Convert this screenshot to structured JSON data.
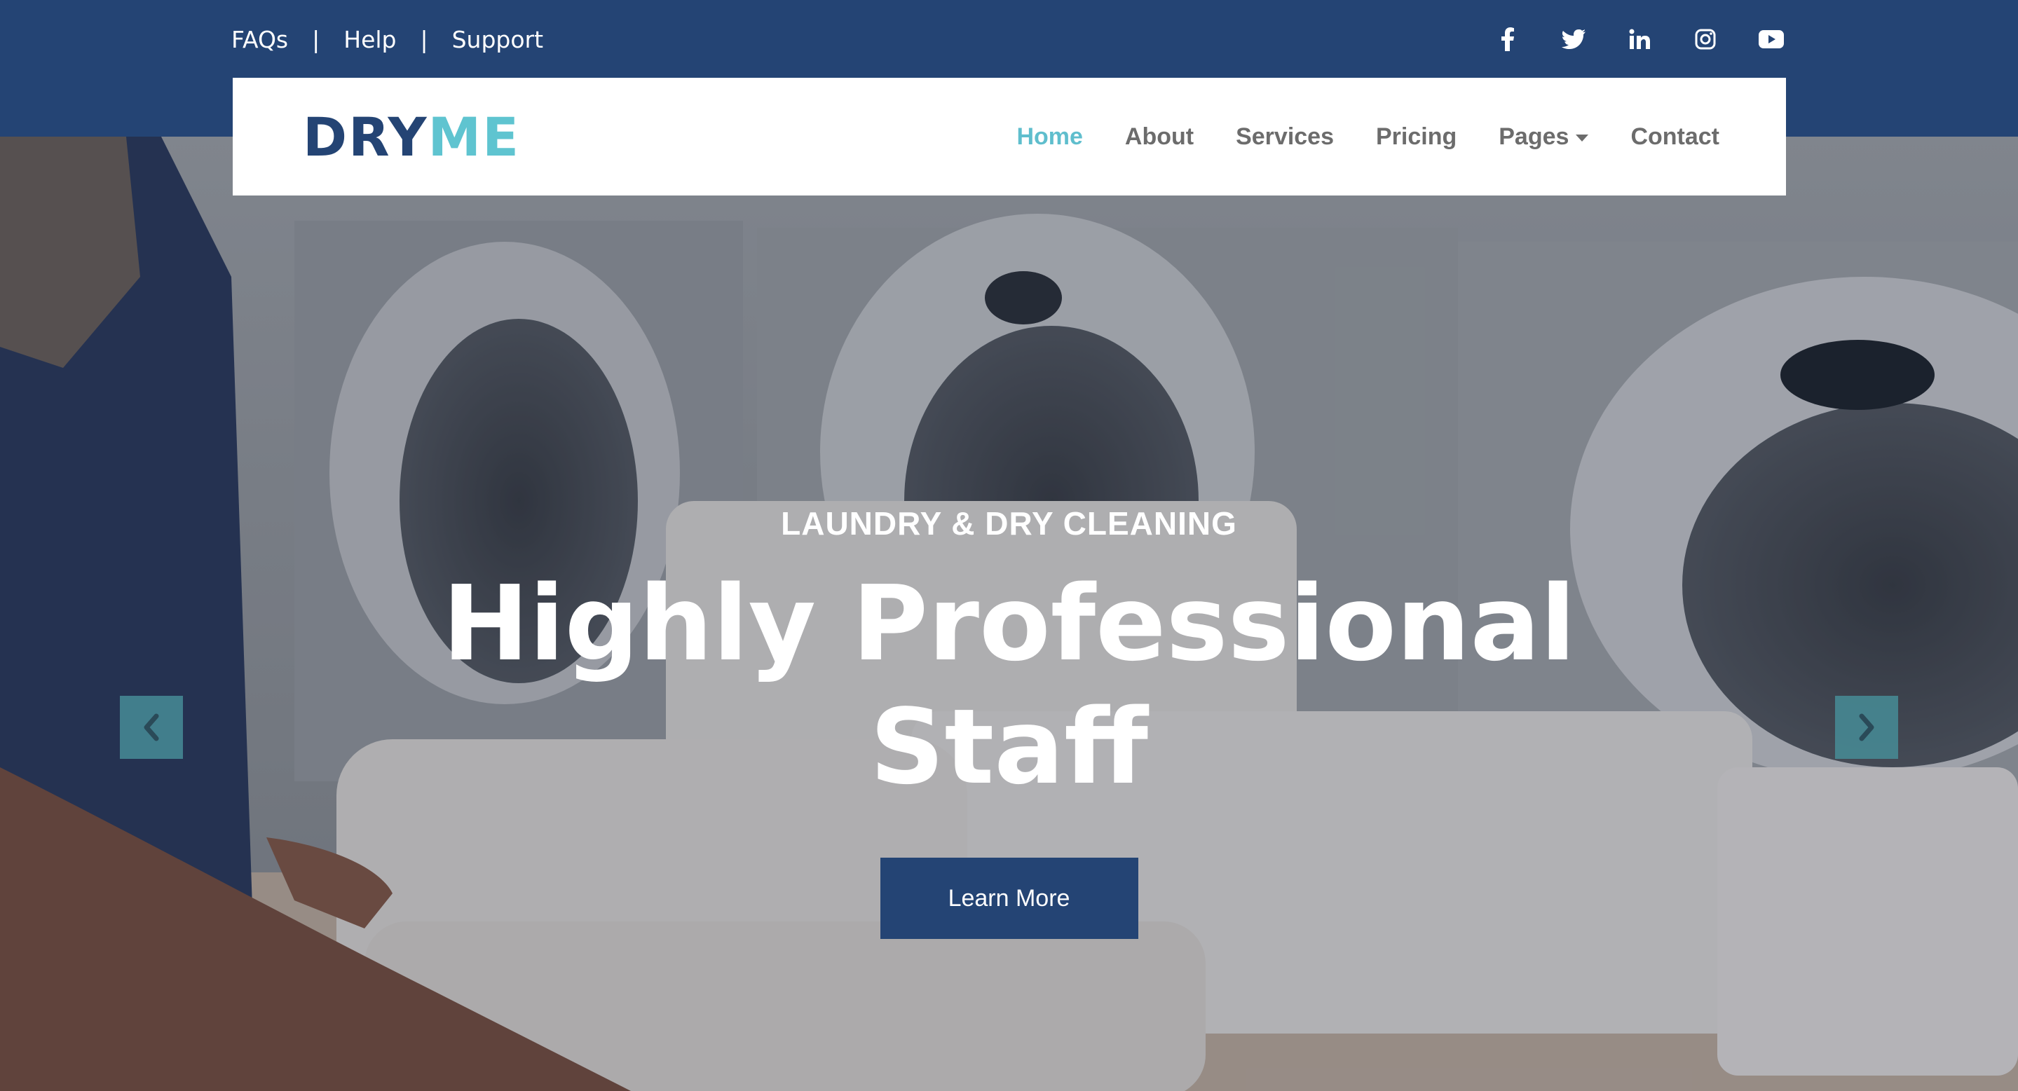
{
  "topbar": {
    "links": [
      "FAQs",
      "Help",
      "Support"
    ],
    "separator": "|",
    "social": [
      "facebook-icon",
      "twitter-icon",
      "linkedin-icon",
      "instagram-icon",
      "youtube-icon"
    ]
  },
  "logo": {
    "part1": "DRY",
    "part2": "ME"
  },
  "nav": {
    "items": [
      "Home",
      "About",
      "Services",
      "Pricing",
      "Pages",
      "Contact"
    ],
    "active": "Home"
  },
  "hero": {
    "eyebrow": "LAUNDRY & DRY CLEANING",
    "headline_line1": "Highly Professional",
    "headline_line2": "Staff",
    "cta": "Learn More"
  },
  "colors": {
    "primary": "#244474",
    "accent": "#5fc4d0",
    "nav_text": "#6c6c6c"
  }
}
